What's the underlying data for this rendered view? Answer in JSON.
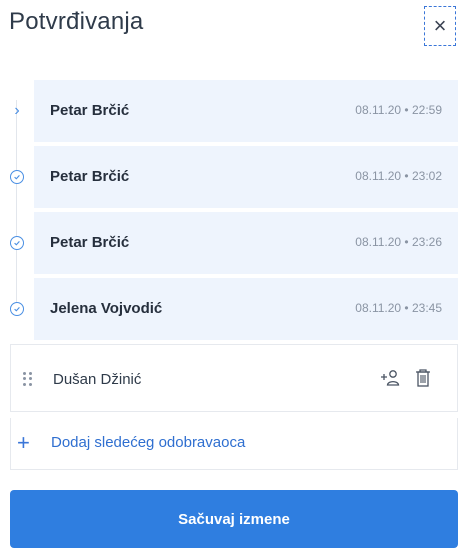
{
  "header": {
    "title": "Potvrđivanja",
    "close_label": "×"
  },
  "approvers": [
    {
      "name": "Petar Brčić",
      "timestamp": "08.11.20 • 22:59",
      "state": "current",
      "icon": "chevron-right-icon"
    },
    {
      "name": "Petar Brčić",
      "timestamp": "08.11.20 • 23:02",
      "state": "approved",
      "icon": "check-circle-icon"
    },
    {
      "name": "Petar Brčić",
      "timestamp": "08.11.20 • 23:26",
      "state": "approved",
      "icon": "check-circle-icon"
    },
    {
      "name": "Jelena Vojvodić",
      "timestamp": "08.11.20 • 23:45",
      "state": "approved",
      "icon": "check-circle-icon"
    }
  ],
  "draft": {
    "name": "Dušan Džinić",
    "icons": [
      "drag-handle-icon",
      "add-user-icon",
      "trash-icon"
    ]
  },
  "add_next": {
    "label": "Dodaj sledećeg odobravaoca",
    "icon": "plus-icon"
  },
  "save_button": {
    "label": "Sačuvaj izmene"
  },
  "colors": {
    "accent": "#2f7ee0",
    "row_background": "#eef4fd",
    "link": "#2f6fd0"
  }
}
